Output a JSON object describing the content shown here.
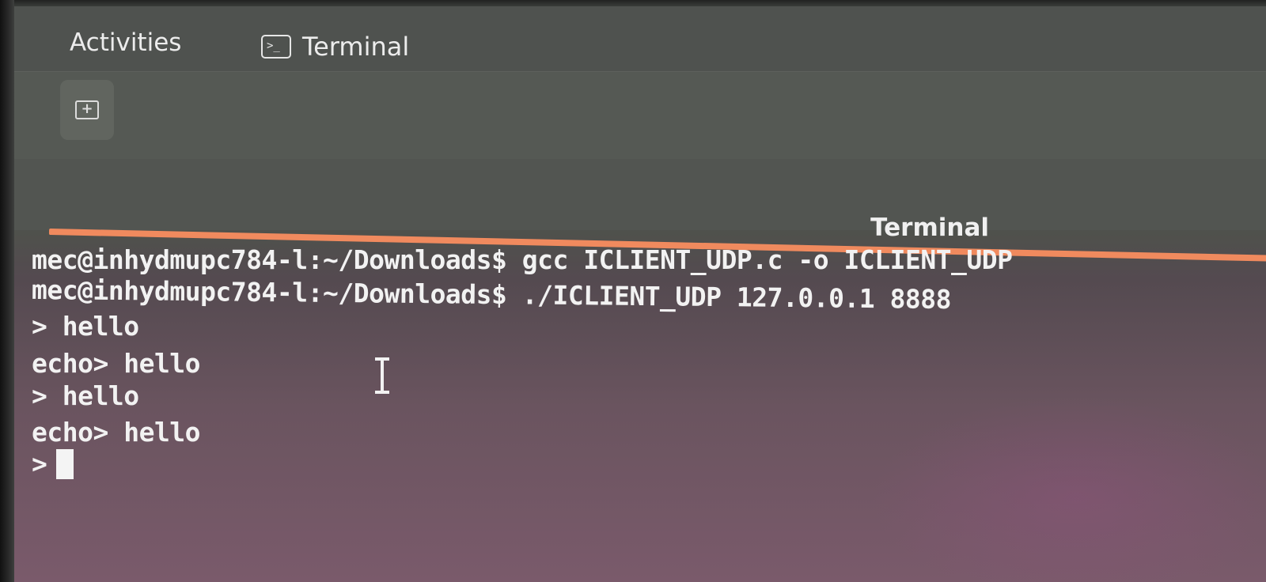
{
  "topbar": {
    "activities_label": "Activities",
    "app_name": "Terminal",
    "app_icon_glyph": ">_"
  },
  "headerbar": {
    "new_tab_glyph": "+"
  },
  "window": {
    "title": "Terminal",
    "accent_color": "#f08a5e"
  },
  "terminal": {
    "lines": [
      "mec@inhydmupc784-l:~/Downloads$ gcc ICLIENT_UDP.c -o ICLIENT_UDP",
      "mec@inhydmupc784-l:~/Downloads$ ./ICLIENT_UDP 127.0.0.1 8888",
      "> hello",
      "echo> hello",
      "> hello",
      "echo> hello",
      ">"
    ]
  }
}
